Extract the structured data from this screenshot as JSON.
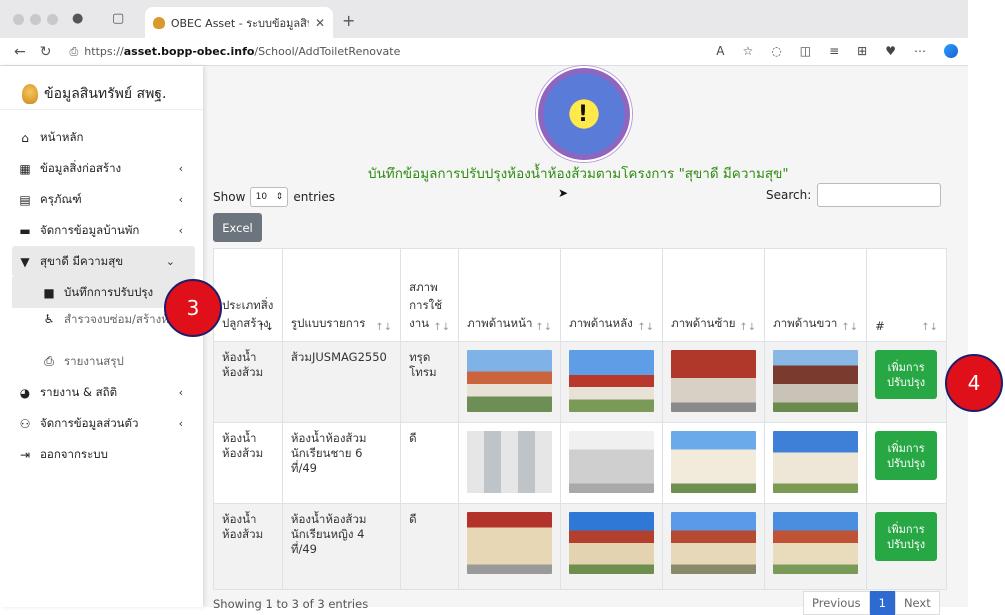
{
  "browser": {
    "tab_title": "OBEC Asset - ระบบข้อมูลสินทรัพ",
    "url_prefix": "https://",
    "url_host": "asset.bopp-obec.info",
    "url_path": "/School/AddToiletRenovate"
  },
  "sidebar": {
    "brand": "ข้อมูลสินทรัพย์ สพฐ.",
    "items": [
      {
        "label": "หน้าหลัก",
        "icon": "home-icon"
      },
      {
        "label": "ข้อมูลสิ่งก่อสร้าง",
        "icon": "building-icon"
      },
      {
        "label": "ครุภัณฑ์",
        "icon": "equipment-icon"
      },
      {
        "label": "จัดการข้อมูลบ้านพัก",
        "icon": "bed-icon"
      },
      {
        "label": "สุขาดี มีความสุข",
        "icon": "toilet-icon"
      },
      {
        "label": "บันทึกการปรับปรุง",
        "icon": "record-icon"
      },
      {
        "label": "สำรวจงบซ่อม/สร้างห้องส้วม",
        "icon": "survey-icon"
      },
      {
        "label": "รายงานสรุป",
        "icon": "print-icon"
      },
      {
        "label": "รายงาน & สถิติ",
        "icon": "chart-icon"
      },
      {
        "label": "จัดการข้อมูลส่วนตัว",
        "icon": "user-icon"
      },
      {
        "label": "ออกจากระบบ",
        "icon": "logout-icon"
      }
    ]
  },
  "main": {
    "title": "บันทึกข้อมูลการปรับปรุงห้องน้ำห้องส้วมตามโครงการ \"สุขาดี มีความสุข\"",
    "show_label": "Show",
    "entries_value": "10",
    "entries_label": "entries",
    "search_label": "Search:",
    "excel_label": "Excel",
    "columns": [
      "ประเภทสิ่งปลูกสร้าง",
      "รูปแบบรายการ",
      "สภาพการใช้งาน",
      "ภาพด้านหน้า",
      "ภาพด้านหลัง",
      "ภาพด้านซ้าย",
      "ภาพด้านขวา",
      "#"
    ],
    "rows": [
      {
        "type": "ห้องน้ำห้องส้วม",
        "model": "ส้วมJUSMAG2550",
        "condition": "ทรุดโทรม",
        "action": "เพิ่มการปรับปรุง"
      },
      {
        "type": "ห้องน้ำห้องส้วม",
        "model": "ห้องน้ำห้องส้วมนักเรียนชาย 6 ที่/49",
        "condition": "ดี",
        "action": "เพิ่มการปรับปรุง"
      },
      {
        "type": "ห้องน้ำห้องส้วม",
        "model": "ห้องน้ำห้องส้วมนักเรียนหญิง 4 ที่/49",
        "condition": "ดี",
        "action": "เพิ่มการปรับปรุง"
      }
    ],
    "info": "Showing 1 to 3 of 3 entries",
    "pager": {
      "prev": "Previous",
      "current": "1",
      "next": "Next"
    }
  },
  "callouts": {
    "a": "3",
    "b": "4"
  }
}
